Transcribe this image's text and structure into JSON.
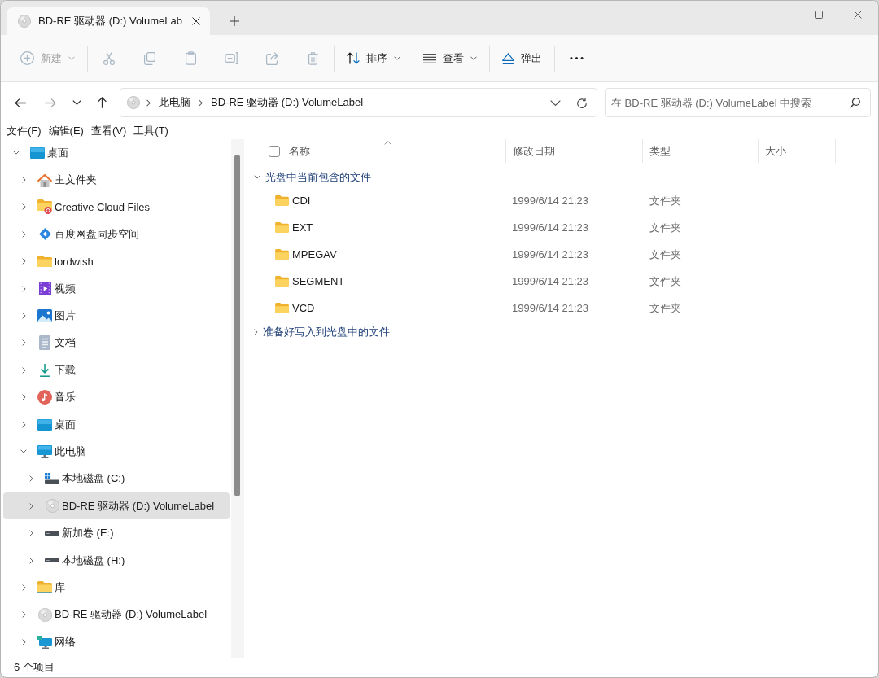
{
  "tabs": [
    {
      "title": "BD-RE 驱动器 (D:) VolumeLab",
      "selected": true
    }
  ],
  "toolbar": {
    "groups": [
      {
        "items": [
          {
            "kind": "new",
            "label": "新建",
            "disabled": true,
            "dropdown": true
          }
        ]
      },
      {
        "items": [
          {
            "kind": "cut",
            "disabled": true,
            "dropdown": false
          },
          {
            "kind": "copy",
            "disabled": true,
            "dropdown": false
          },
          {
            "kind": "paste",
            "disabled": true,
            "dropdown": false
          },
          {
            "kind": "rename",
            "disabled": true,
            "dropdown": false
          },
          {
            "kind": "share",
            "disabled": true,
            "dropdown": false
          },
          {
            "kind": "delete",
            "disabled": true,
            "dropdown": false
          }
        ]
      },
      {
        "items": [
          {
            "kind": "sort",
            "label": "排序",
            "disabled": false,
            "dropdown": true
          },
          {
            "kind": "view",
            "label": "查看",
            "disabled": false,
            "dropdown": true
          }
        ]
      },
      {
        "items": [
          {
            "kind": "eject",
            "label": "弹出",
            "disabled": false,
            "dropdown": false
          }
        ]
      },
      {
        "items": [
          {
            "kind": "more",
            "disabled": false,
            "dropdown": false
          }
        ]
      }
    ]
  },
  "navigation": {
    "buttons": [
      {
        "kind": "back",
        "disabled": false
      },
      {
        "kind": "forward",
        "disabled": true
      },
      {
        "kind": "recent",
        "disabled": false
      },
      {
        "kind": "up",
        "disabled": false
      }
    ]
  },
  "address_bar": {
    "crumbs": [
      "此电脑",
      "BD-RE 驱动器 (D:) VolumeLabel"
    ]
  },
  "search": {
    "placeholder": "在 BD-RE 驱动器 (D:) VolumeLabel 中搜索"
  },
  "menu_bar": [
    "文件(F)",
    "编辑(E)",
    "查看(V)",
    "工具(T)"
  ],
  "sidebar": {
    "items": [
      {
        "label": "桌面",
        "kind": "desktop",
        "expanded": true,
        "selected": false,
        "children": [
          {
            "label": "主文件夹",
            "kind": "home",
            "expanded": false,
            "selected": false
          },
          {
            "label": "Creative Cloud Files",
            "kind": "cloudfolder",
            "expanded": false,
            "selected": false
          },
          {
            "label": "百度网盘同步空间",
            "kind": "syncfolder",
            "expanded": false,
            "selected": false
          },
          {
            "label": "lordwish",
            "kind": "folder",
            "expanded": false,
            "selected": false
          },
          {
            "label": "视频",
            "kind": "videos",
            "expanded": false,
            "selected": false
          },
          {
            "label": "图片",
            "kind": "pictures",
            "expanded": false,
            "selected": false
          },
          {
            "label": "文档",
            "kind": "documents",
            "expanded": false,
            "selected": false
          },
          {
            "label": "下载",
            "kind": "downloads",
            "expanded": false,
            "selected": false
          },
          {
            "label": "音乐",
            "kind": "music",
            "expanded": false,
            "selected": false
          },
          {
            "label": "桌面",
            "kind": "desktop",
            "expanded": false,
            "selected": false
          },
          {
            "label": "此电脑",
            "kind": "computer",
            "expanded": true,
            "selected": false,
            "children": [
              {
                "label": "本地磁盘 (C:)",
                "kind": "systemdrive",
                "expanded": false,
                "selected": false
              },
              {
                "label": "BD-RE 驱动器 (D:) VolumeLabel",
                "kind": "disc",
                "expanded": false,
                "selected": true
              },
              {
                "label": "新加卷 (E:)",
                "kind": "drive",
                "expanded": false,
                "selected": false
              },
              {
                "label": "本地磁盘 (H:)",
                "kind": "drive",
                "expanded": false,
                "selected": false
              }
            ]
          },
          {
            "label": "库",
            "kind": "libraries",
            "expanded": false,
            "selected": false
          },
          {
            "label": "BD-RE 驱动器 (D:) VolumeLabel",
            "kind": "disc",
            "expanded": false,
            "selected": false
          },
          {
            "label": "网络",
            "kind": "network",
            "expanded": false,
            "selected": false
          }
        ]
      }
    ]
  },
  "file_list": {
    "select_all": {
      "checked": false
    },
    "columns": [
      {
        "label": "名称",
        "sorted": true
      },
      {
        "label": "修改日期",
        "sorted": false
      },
      {
        "label": "类型",
        "sorted": false
      },
      {
        "label": "大小",
        "sorted": false
      }
    ],
    "groups": [
      {
        "title": "光盘中当前包含的文件",
        "expanded": true,
        "rows": [
          {
            "name": "CDI",
            "date": "1999/6/14 21:23",
            "type": "文件夹",
            "selected": false
          },
          {
            "name": "EXT",
            "date": "1999/6/14 21:23",
            "type": "文件夹",
            "selected": false
          },
          {
            "name": "MPEGAV",
            "date": "1999/6/14 21:23",
            "type": "文件夹",
            "selected": false
          },
          {
            "name": "SEGMENT",
            "date": "1999/6/14 21:23",
            "type": "文件夹",
            "selected": false
          },
          {
            "name": "VCD",
            "date": "1999/6/14 21:23",
            "type": "文件夹",
            "selected": false
          }
        ]
      },
      {
        "title": "准备好写入到光盘中的文件",
        "expanded": false
      }
    ]
  },
  "status_bar": {
    "item_count": "6 个项目"
  }
}
